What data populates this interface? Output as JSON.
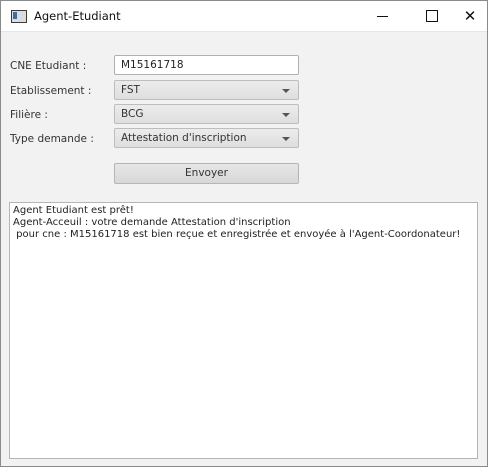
{
  "window": {
    "title": "Agent-Etudiant",
    "controls": {
      "minimize": "–",
      "maximize": "□",
      "close": "✕"
    }
  },
  "form": {
    "cne": {
      "label": "CNE Etudiant :",
      "value": "M15161718"
    },
    "etablissement": {
      "label": "Etablissement :",
      "value": "FST"
    },
    "filiere": {
      "label": "Filière :",
      "value": "BCG"
    },
    "type_demande": {
      "label": "Type demande :",
      "value": "Attestation d'inscription"
    },
    "send_label": "Envoyer"
  },
  "console": {
    "lines": [
      "Agent Etudiant est prêt!",
      "Agent-Acceuil : votre demande Attestation d'inscription",
      " pour cne : M15161718 est bien reçue et enregistrée et envoyée à l'Agent-Coordonateur!"
    ]
  },
  "icons": {
    "app": "app-window-icon",
    "dropdown": "chevron-down-icon"
  }
}
